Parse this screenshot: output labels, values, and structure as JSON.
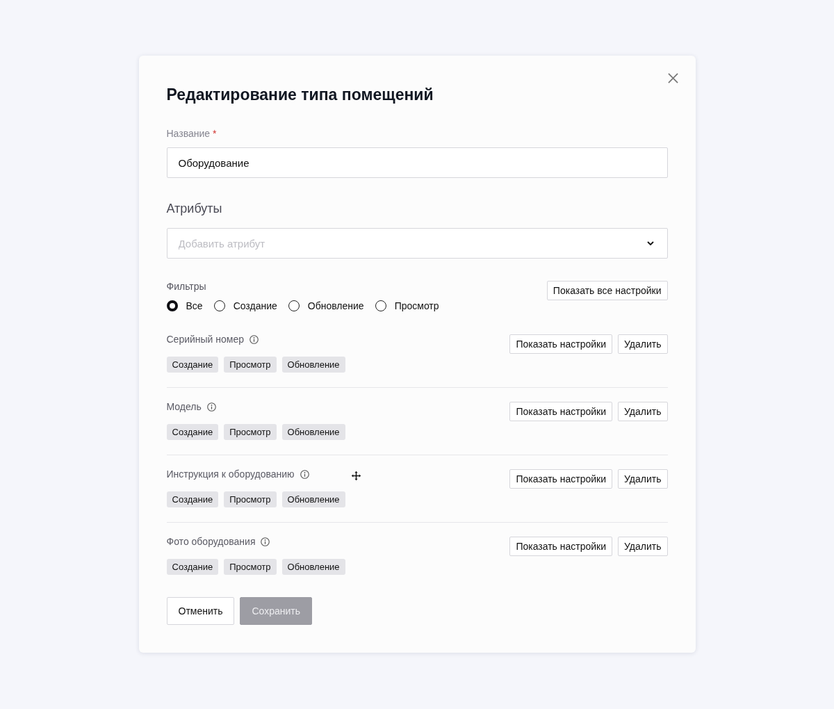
{
  "dialog": {
    "title": "Редактирование типа помещений"
  },
  "name_field": {
    "label": "Название",
    "required_mark": "*",
    "value": "Оборудование"
  },
  "attributes_section": {
    "title": "Атрибуты",
    "select": {
      "placeholder": "Добавить атрибут"
    }
  },
  "filters": {
    "label": "Фильтры",
    "options": [
      {
        "label": "Все",
        "selected": true
      },
      {
        "label": "Создание",
        "selected": false
      },
      {
        "label": "Обновление",
        "selected": false
      },
      {
        "label": "Просмотр",
        "selected": false
      }
    ],
    "show_all_button": "Показать все настройки"
  },
  "attributes": [
    {
      "name": "Серийный номер",
      "tags": [
        "Создание",
        "Просмотр",
        "Обновление"
      ],
      "settings_button": "Показать настройки",
      "delete_button": "Удалить"
    },
    {
      "name": "Модель",
      "tags": [
        "Создание",
        "Просмотр",
        "Обновление"
      ],
      "settings_button": "Показать настройки",
      "delete_button": "Удалить"
    },
    {
      "name": "Инструкция к оборудованию",
      "tags": [
        "Создание",
        "Просмотр",
        "Обновление"
      ],
      "settings_button": "Показать настройки",
      "delete_button": "Удалить"
    },
    {
      "name": "Фото оборудования",
      "tags": [
        "Создание",
        "Просмотр",
        "Обновление"
      ],
      "settings_button": "Показать настройки",
      "delete_button": "Удалить"
    }
  ],
  "buttons": [
    {
      "label": "Отменить",
      "kind": "secondary",
      "disabled": false
    },
    {
      "label": "Сохранить",
      "kind": "primary",
      "disabled": true
    }
  ]
}
